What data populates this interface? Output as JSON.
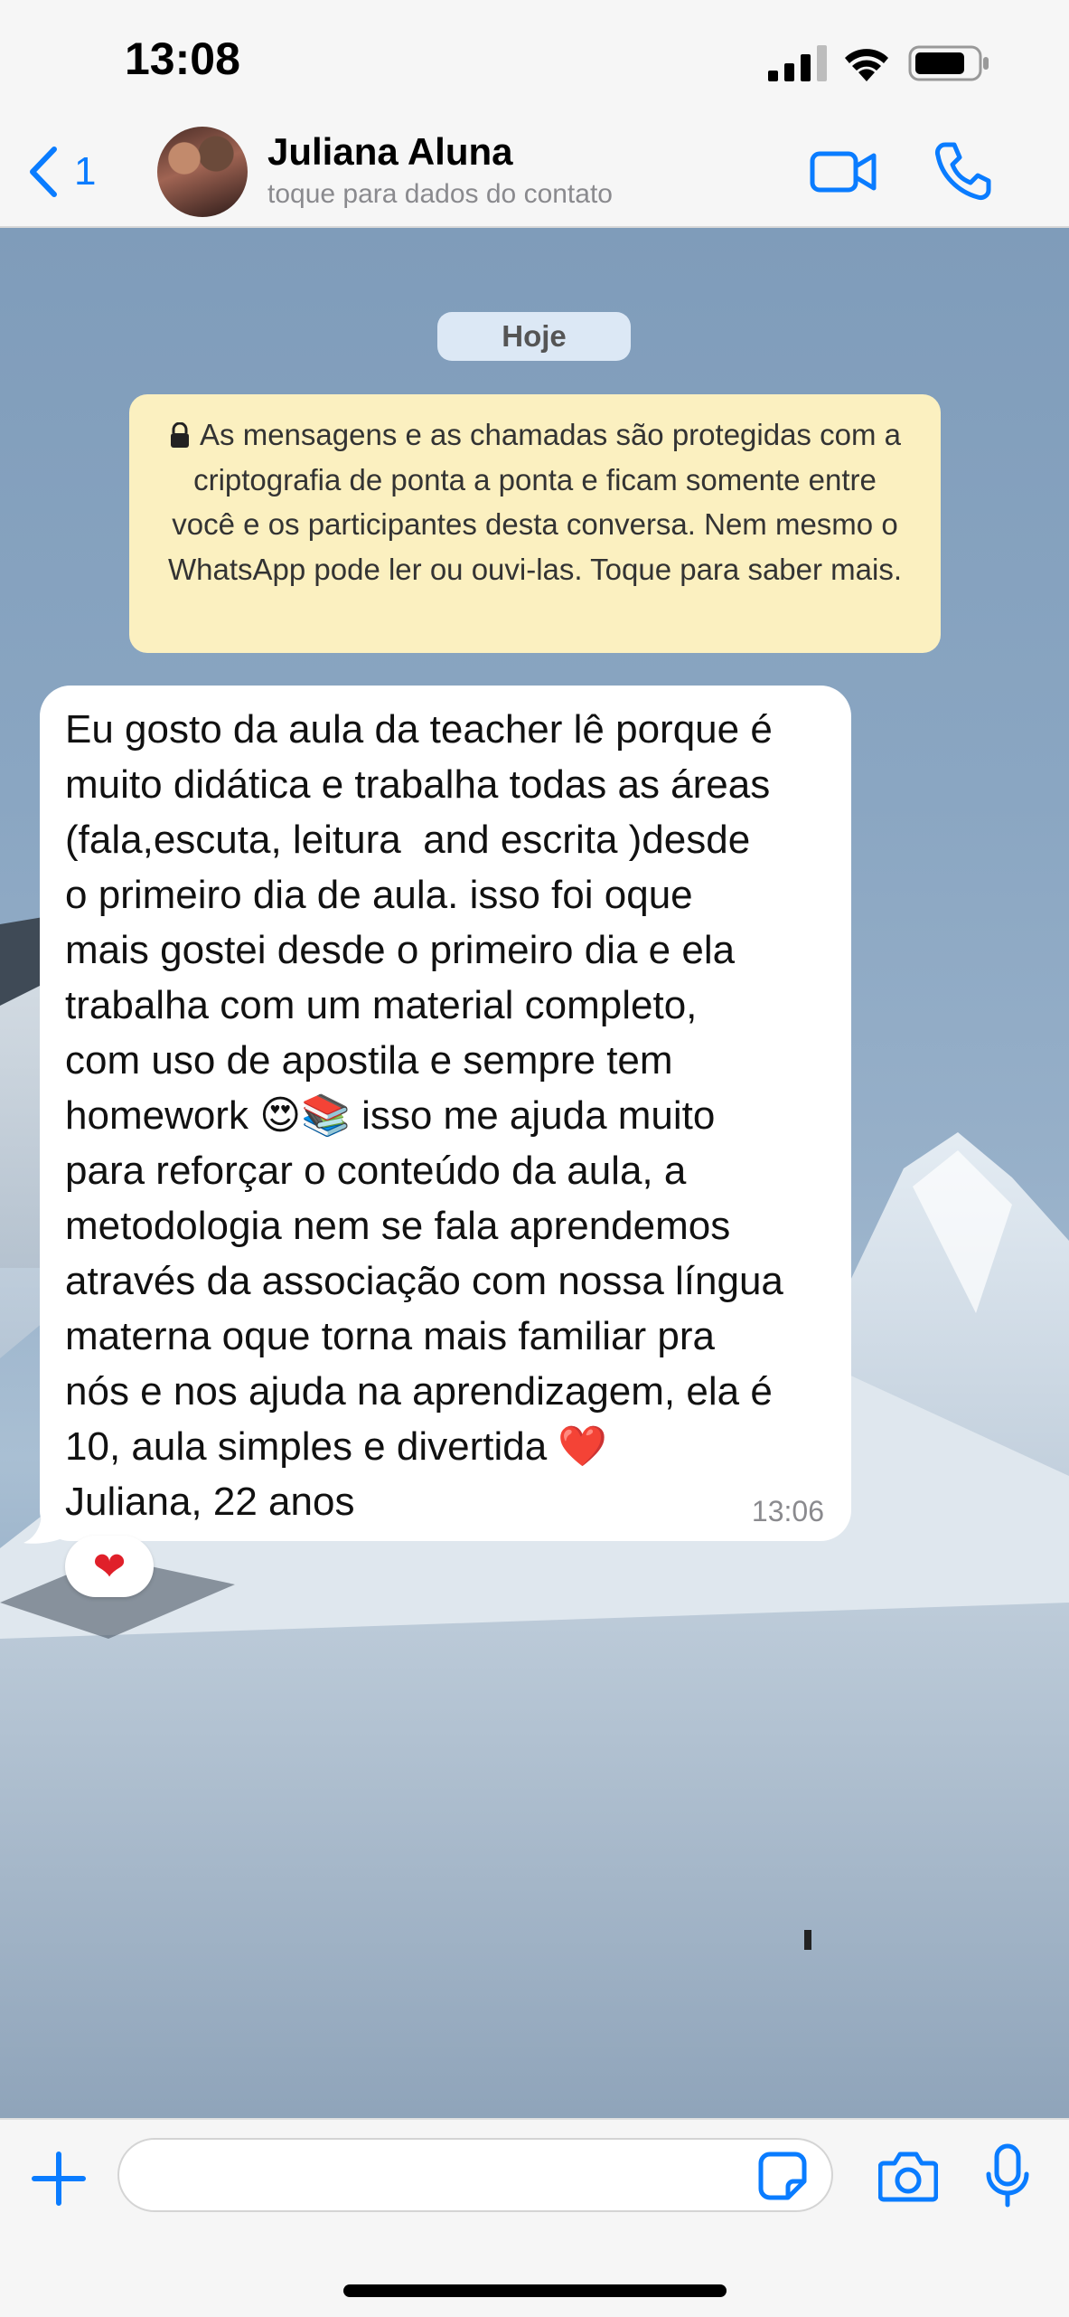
{
  "status_bar": {
    "time": "13:08"
  },
  "header": {
    "back_count": "1",
    "contact_name": "Juliana Aluna",
    "contact_subtitle": "toque para dados do contato"
  },
  "chat": {
    "date_label": "Hoje",
    "encryption_notice": "As mensagens e as chamadas são protegidas com a criptografia de ponta a ponta e ficam somente entre você e os participantes desta conversa. Nem mesmo o WhatsApp pode ler ou ouvi-las. Toque para saber mais.",
    "messages": [
      {
        "text": "Eu gosto da aula da teacher lê porque é\nmuito didática e trabalha todas as áreas\n(fala,escuta, leitura  and escrita )desde\no primeiro dia de aula. isso foi oque\nmais gostei desde o primeiro dia e ela\ntrabalha com um material completo,\ncom uso de apostila e sempre tem\nhomework 😍📚 isso me ajuda muito\npara reforçar o conteúdo da aula, a\nmetodologia nem se fala aprendemos\natravés da associação com nossa língua\nmaterna oque torna mais familiar pra\nnós e nos ajuda na aprendizagem, ela é\n10, aula simples e divertida ❤️\nJuliana, 22 anos",
        "time": "13:06",
        "reaction": "❤"
      }
    ]
  },
  "input": {
    "placeholder": ""
  },
  "icons": {
    "back": "chevron-left-icon",
    "video": "video-camera-icon",
    "call": "phone-icon",
    "lock": "lock-icon",
    "plus": "plus-icon",
    "sticker": "sticker-icon",
    "camera": "camera-icon",
    "mic": "microphone-icon"
  },
  "colors": {
    "accent": "#0a7cff",
    "encryption_bg": "#fbf0c0",
    "bubble_bg": "#ffffff",
    "date_pill_bg": "#dce8f5"
  }
}
